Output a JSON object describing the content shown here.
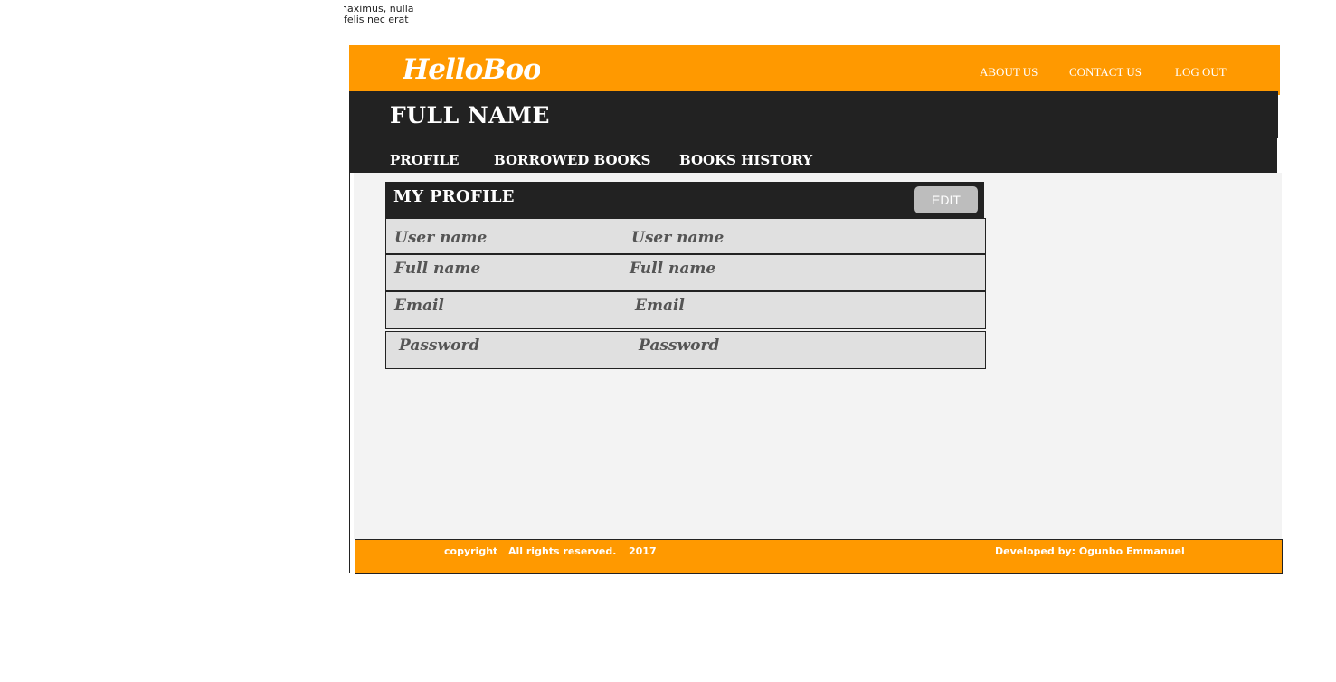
{
  "clipped_text": {
    "line1": "naximus, nulla",
    "line2": "felis nec erat"
  },
  "header": {
    "logo": "HelloBooks",
    "nav": [
      "ABOUT US",
      "CONTACT US",
      "LOG OUT"
    ]
  },
  "user_bar": {
    "title": "FULL NAME",
    "tabs": [
      "PROFILE",
      "BORROWED BOOKS",
      "BOOKS HISTORY"
    ]
  },
  "profile": {
    "title": "MY PROFILE",
    "edit_label": "EDIT",
    "rows": [
      {
        "label": "User name",
        "value": "User name"
      },
      {
        "label": "Full name",
        "value": "Full name"
      },
      {
        "label": "Email",
        "value": "Email"
      },
      {
        "label": "Password",
        "value": "Password"
      }
    ]
  },
  "footer": {
    "copyright": "copyright",
    "rights": "All rights reserved.",
    "year": "2017",
    "developer": "Developed by: Ogunbo Emmanuel"
  },
  "colors": {
    "accent": "#ff9900",
    "dark": "#222222",
    "content_bg": "#f3f3f3",
    "row_bg": "#e0e0e0"
  }
}
